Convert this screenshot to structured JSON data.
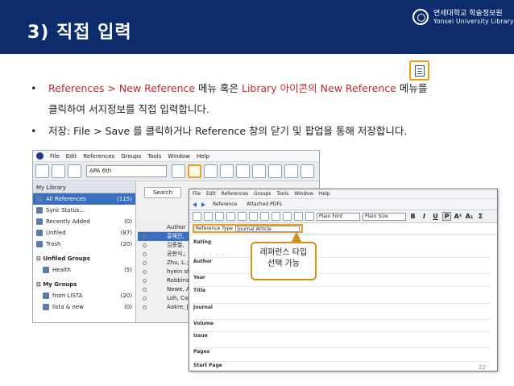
{
  "header": {
    "title": "3) 직접 입력",
    "university_ko": "연세대학교 학술정보원",
    "university_en": "Yonsei University Library"
  },
  "bullets": [
    {
      "parts": [
        {
          "text": "References > New Reference",
          "color": "red"
        },
        {
          "text": " 메뉴 혹은 ",
          "color": "black"
        },
        {
          "text": "Library",
          "color": "red"
        },
        {
          "text": " 아이콘의 ",
          "color": "red"
        },
        {
          "text": "New Reference",
          "color": "red"
        },
        {
          "text": " 메뉴를",
          "color": "black"
        }
      ],
      "line2": "클릭하여 서지정보를 직접 입력합니다."
    },
    {
      "text": "저장: File > Save 를 클릭하거나 Reference 창의 닫기 및 팝업을 통해 저장합니다."
    }
  ],
  "screenshot1": {
    "menu": [
      "File",
      "Edit",
      "References",
      "Groups",
      "Tools",
      "Window",
      "Help"
    ],
    "style": "APA 6th",
    "my_library": "My Library",
    "groups": [
      {
        "label": "All References",
        "count": "(115)",
        "selected": true
      },
      {
        "label": "Sync Status...",
        "count": ""
      },
      {
        "label": "Recently Added",
        "count": "(0)"
      },
      {
        "label": "Unfiled",
        "count": "(87)"
      },
      {
        "label": "Trash",
        "count": "(20)"
      }
    ],
    "unfiled_groups_title": "Unfiled Groups",
    "unfiled_groups": [
      {
        "label": "Health",
        "count": "(5)"
      }
    ],
    "my_groups_title": "My Groups",
    "my_groups": [
      {
        "label": "from LISTA",
        "count": "(20)"
      },
      {
        "label": "lista & new",
        "count": "(0)"
      }
    ],
    "search_label": "Search",
    "col_author": "Author",
    "ref_authors": [
      "홍혜진,",
      "김종철,",
      "공판식,;",
      "Zhu, L.;",
      "hyein sh",
      "Robbins,",
      "Newe, A",
      "Loh, Can",
      "Aakre, J."
    ]
  },
  "screenshot2": {
    "menu": [
      "File",
      "Edit",
      "References",
      "Groups",
      "Tools",
      "Window",
      "Help"
    ],
    "tab_reference": "Reference",
    "tab_pdfs": "Attached PDFs",
    "font": "Plain Font",
    "size": "Plain Size",
    "format_buttons": [
      "B",
      "I",
      "U",
      "P",
      "A¹",
      "A₁",
      "Σ"
    ],
    "reftype_label": "Reference Type",
    "reftype_value": "Journal Article",
    "fields": [
      "Rating",
      "Author",
      "Year",
      "Title",
      "Journal",
      "Volume",
      "Issue",
      "Pages",
      "Start Page"
    ],
    "rating_dots": "· · · · ·"
  },
  "callout": {
    "line1": "레퍼런스 타입",
    "line2": "선택 가능"
  },
  "page_number": "22",
  "colors": {
    "header_bg": "#0d2c6b",
    "highlight": "#f0a020",
    "red_text": "#c0272d"
  }
}
